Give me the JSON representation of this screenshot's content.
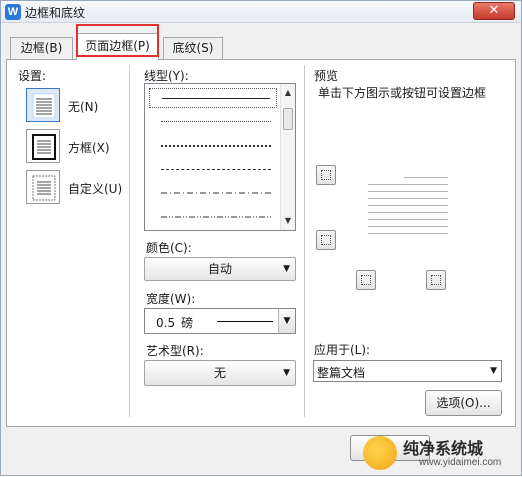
{
  "window": {
    "title": "边框和底纹",
    "app_icon": "W",
    "close_glyph": "✕"
  },
  "tabs": [
    {
      "label": "边框(B)",
      "active": false
    },
    {
      "label": "页面边框(P)",
      "active": true
    },
    {
      "label": "底纹(S)",
      "active": false
    }
  ],
  "settings": {
    "heading": "设置:",
    "items": [
      {
        "label": "无(N)",
        "icon": "no-border-icon"
      },
      {
        "label": "方框(X)",
        "icon": "box-border-icon"
      },
      {
        "label": "自定义(U)",
        "icon": "custom-border-icon"
      }
    ]
  },
  "line_style": {
    "label": "线型(Y):",
    "styles": [
      "solid",
      "dotted-fine",
      "dotted",
      "dashed",
      "dash-dot",
      "dash-dot-dot"
    ]
  },
  "color": {
    "label": "颜色(C):",
    "value": "自动"
  },
  "width": {
    "label": "宽度(W):",
    "value": "0.5",
    "unit": "磅"
  },
  "art": {
    "label": "艺术型(R):",
    "value": "无"
  },
  "preview": {
    "heading": "预览",
    "hint": "单击下方图示或按钮可设置边框"
  },
  "apply_to": {
    "label": "应用于(L):",
    "value": "整篇文档"
  },
  "buttons": {
    "options": "选项(O)..."
  },
  "watermark": {
    "main": "纯净系统城",
    "sub": "www.yidaimei.com"
  },
  "colors": {
    "highlight": "#e0322e",
    "accent": "#2d7ad6"
  }
}
